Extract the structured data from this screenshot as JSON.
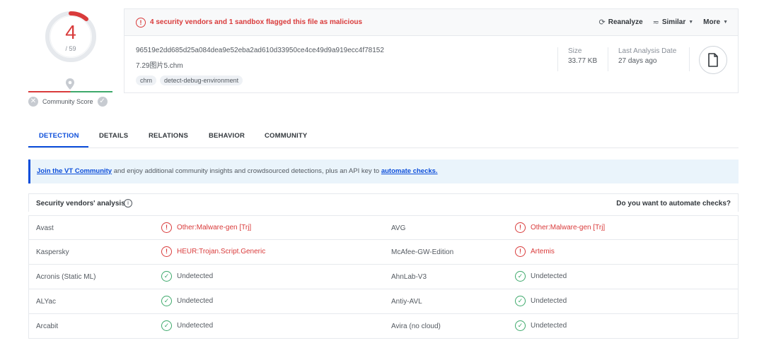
{
  "score": {
    "detections": "4",
    "total": "/ 59",
    "community_label": "Community Score"
  },
  "summary": {
    "flag_text": "4 security vendors and 1 sandbox flagged this file as malicious",
    "actions": {
      "reanalyze": "Reanalyze",
      "similar": "Similar",
      "more": "More"
    },
    "hash": "96519e2dd685d25a084dea9e52eba2ad610d33950ce4ce49d9a919ecc4f78152",
    "filename": "7.29图片5.chm",
    "tags": [
      "chm",
      "detect-debug-environment"
    ],
    "size_label": "Size",
    "size_value": "33.77 KB",
    "date_label": "Last Analysis Date",
    "date_value": "27 days ago"
  },
  "tabs": [
    "DETECTION",
    "DETAILS",
    "RELATIONS",
    "BEHAVIOR",
    "COMMUNITY"
  ],
  "banner": {
    "link1": "Join the VT Community",
    "middle": " and enjoy additional community insights and crowdsourced detections, plus an API key to ",
    "link2": "automate checks."
  },
  "vendors_header": {
    "title": "Security vendors' analysis",
    "right": "Do you want to automate checks?"
  },
  "rows": [
    {
      "left_vendor": "Avast",
      "left_result": "Other:Malware-gen [Trj]",
      "left_status": "bad",
      "right_vendor": "AVG",
      "right_result": "Other:Malware-gen [Trj]",
      "right_status": "bad"
    },
    {
      "left_vendor": "Kaspersky",
      "left_result": "HEUR:Trojan.Script.Generic",
      "left_status": "bad",
      "right_vendor": "McAfee-GW-Edition",
      "right_result": "Artemis",
      "right_status": "bad"
    },
    {
      "left_vendor": "Acronis (Static ML)",
      "left_result": "Undetected",
      "left_status": "good",
      "right_vendor": "AhnLab-V3",
      "right_result": "Undetected",
      "right_status": "good"
    },
    {
      "left_vendor": "ALYac",
      "left_result": "Undetected",
      "left_status": "good",
      "right_vendor": "Antiy-AVL",
      "right_result": "Undetected",
      "right_status": "good"
    },
    {
      "left_vendor": "Arcabit",
      "left_result": "Undetected",
      "left_status": "good",
      "right_vendor": "Avira (no cloud)",
      "right_result": "Undetected",
      "right_status": "good"
    }
  ]
}
